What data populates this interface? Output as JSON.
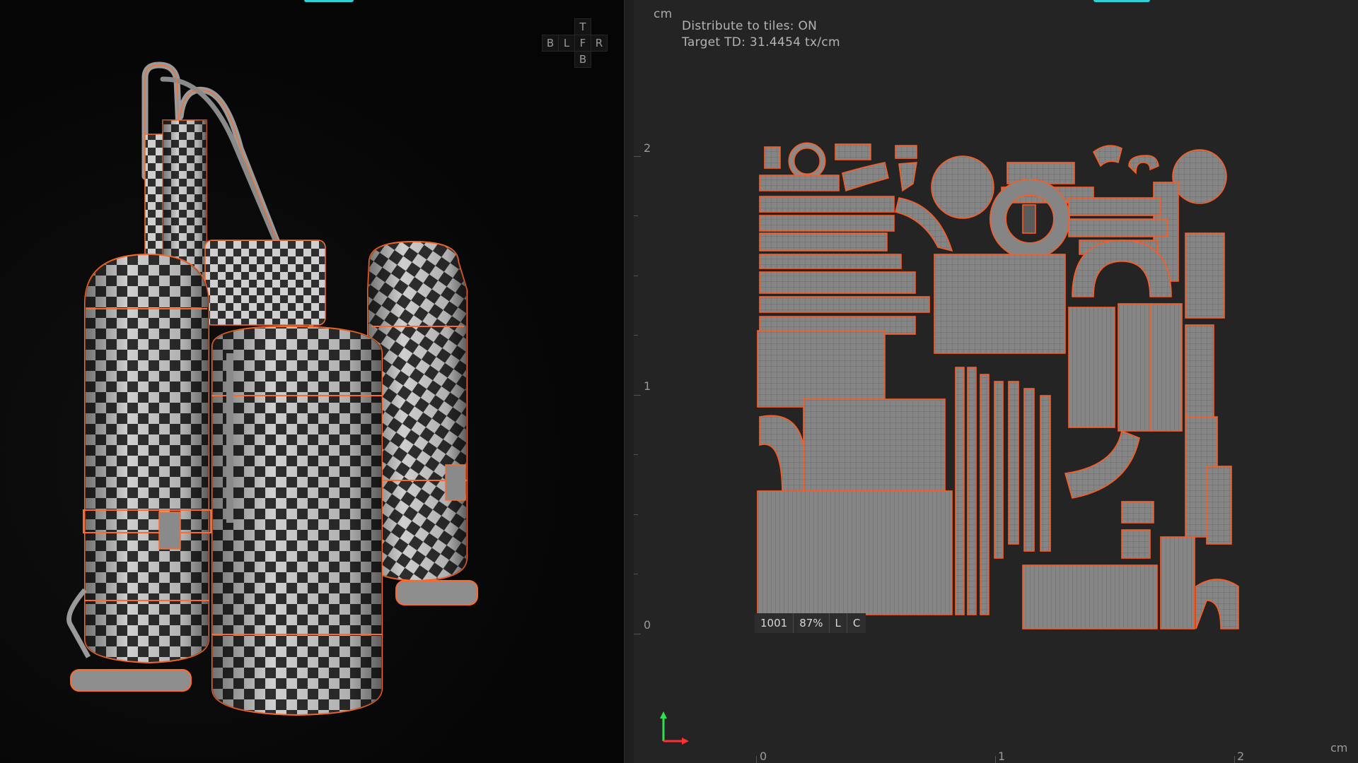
{
  "viewport3d": {
    "navcube": {
      "top": "T",
      "back": "B",
      "left": "L",
      "front": "F",
      "right": "R",
      "bottom": "B"
    }
  },
  "uv_editor": {
    "unit_top": "cm",
    "unit_bottom": "cm",
    "overlay": {
      "line1": "Distribute to tiles: ON",
      "line2": "Target TD: 31.4454 tx/cm"
    },
    "v_axis_labels": [
      "2",
      "1",
      "0"
    ],
    "u_axis_labels": [
      "0",
      "1",
      "2"
    ],
    "tile_status": {
      "tile": "1001",
      "coverage": "87%",
      "lock": "L",
      "color": "C"
    },
    "colors": {
      "background": "#242424",
      "tile": "#7f7f7f",
      "seam": "#ff5a1f",
      "accent": "#2fd0d8"
    }
  }
}
